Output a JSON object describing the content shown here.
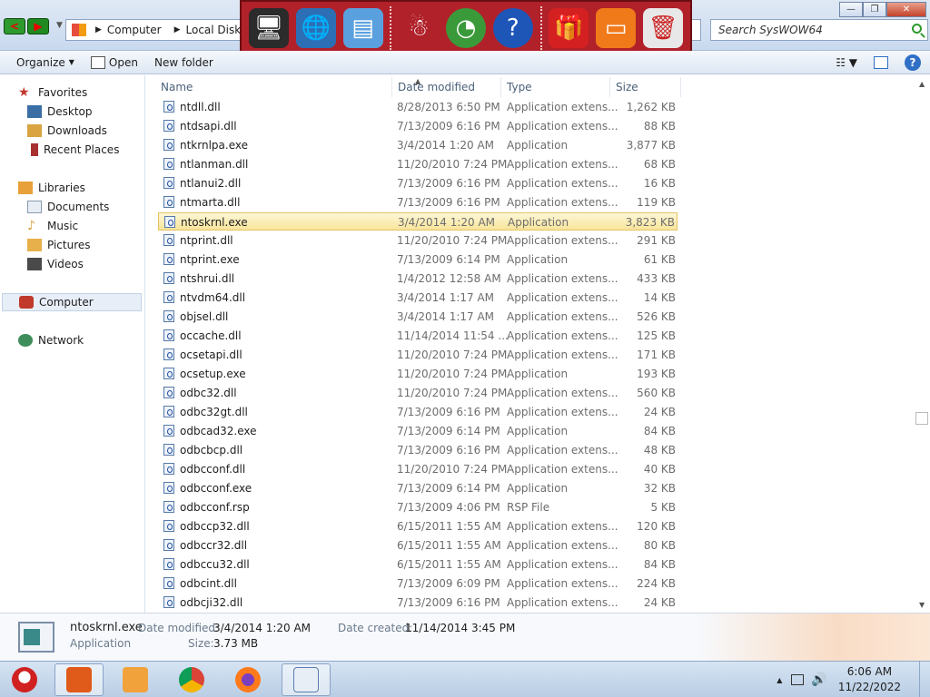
{
  "address": {
    "segments": [
      "Computer",
      "Local Disk (C:)"
    ]
  },
  "search": {
    "placeholder": "Search SysWOW64"
  },
  "window_controls": {
    "minimize": "—",
    "maximize": "❐",
    "close": "✕"
  },
  "nav_buttons": {
    "back": "<",
    "forward": "▶"
  },
  "toolbar": {
    "organize": "Organize",
    "open": "Open",
    "new_folder": "New folder",
    "help": "?"
  },
  "sidebar": {
    "favorites": "Favorites",
    "favorites_items": [
      "Desktop",
      "Downloads",
      "Recent Places"
    ],
    "libraries": "Libraries",
    "libraries_items": [
      "Documents",
      "Music",
      "Pictures",
      "Videos"
    ],
    "computer": "Computer",
    "network": "Network"
  },
  "columns": {
    "name": "Name",
    "date": "Date modified",
    "type": "Type",
    "size": "Size"
  },
  "files": [
    {
      "name": "ntdll.dll",
      "date": "8/28/2013 6:50 PM",
      "type": "Application extens...",
      "size": "1,262 KB"
    },
    {
      "name": "ntdsapi.dll",
      "date": "7/13/2009 6:16 PM",
      "type": "Application extens...",
      "size": "88 KB"
    },
    {
      "name": "ntkrnlpa.exe",
      "date": "3/4/2014 1:20 AM",
      "type": "Application",
      "size": "3,877 KB"
    },
    {
      "name": "ntlanman.dll",
      "date": "11/20/2010 7:24 PM",
      "type": "Application extens...",
      "size": "68 KB"
    },
    {
      "name": "ntlanui2.dll",
      "date": "7/13/2009 6:16 PM",
      "type": "Application extens...",
      "size": "16 KB"
    },
    {
      "name": "ntmarta.dll",
      "date": "7/13/2009 6:16 PM",
      "type": "Application extens...",
      "size": "119 KB"
    },
    {
      "name": "ntoskrnl.exe",
      "date": "3/4/2014 1:20 AM",
      "type": "Application",
      "size": "3,823 KB",
      "selected": true
    },
    {
      "name": "ntprint.dll",
      "date": "11/20/2010 7:24 PM",
      "type": "Application extens...",
      "size": "291 KB"
    },
    {
      "name": "ntprint.exe",
      "date": "7/13/2009 6:14 PM",
      "type": "Application",
      "size": "61 KB"
    },
    {
      "name": "ntshrui.dll",
      "date": "1/4/2012 12:58 AM",
      "type": "Application extens...",
      "size": "433 KB"
    },
    {
      "name": "ntvdm64.dll",
      "date": "3/4/2014 1:17 AM",
      "type": "Application extens...",
      "size": "14 KB"
    },
    {
      "name": "objsel.dll",
      "date": "3/4/2014 1:17 AM",
      "type": "Application extens...",
      "size": "526 KB"
    },
    {
      "name": "occache.dll",
      "date": "11/14/2014 11:54 ...",
      "type": "Application extens...",
      "size": "125 KB"
    },
    {
      "name": "ocsetapi.dll",
      "date": "11/20/2010 7:24 PM",
      "type": "Application extens...",
      "size": "171 KB"
    },
    {
      "name": "ocsetup.exe",
      "date": "11/20/2010 7:24 PM",
      "type": "Application",
      "size": "193 KB"
    },
    {
      "name": "odbc32.dll",
      "date": "11/20/2010 7:24 PM",
      "type": "Application extens...",
      "size": "560 KB"
    },
    {
      "name": "odbc32gt.dll",
      "date": "7/13/2009 6:16 PM",
      "type": "Application extens...",
      "size": "24 KB"
    },
    {
      "name": "odbcad32.exe",
      "date": "7/13/2009 6:14 PM",
      "type": "Application",
      "size": "84 KB"
    },
    {
      "name": "odbcbcp.dll",
      "date": "7/13/2009 6:16 PM",
      "type": "Application extens...",
      "size": "48 KB"
    },
    {
      "name": "odbcconf.dll",
      "date": "11/20/2010 7:24 PM",
      "type": "Application extens...",
      "size": "40 KB"
    },
    {
      "name": "odbcconf.exe",
      "date": "7/13/2009 6:14 PM",
      "type": "Application",
      "size": "32 KB"
    },
    {
      "name": "odbcconf.rsp",
      "date": "7/13/2009 4:06 PM",
      "type": "RSP File",
      "size": "5 KB"
    },
    {
      "name": "odbccp32.dll",
      "date": "6/15/2011 1:55 AM",
      "type": "Application extens...",
      "size": "120 KB"
    },
    {
      "name": "odbccr32.dll",
      "date": "6/15/2011 1:55 AM",
      "type": "Application extens...",
      "size": "80 KB"
    },
    {
      "name": "odbccu32.dll",
      "date": "6/15/2011 1:55 AM",
      "type": "Application extens...",
      "size": "84 KB"
    },
    {
      "name": "odbcint.dll",
      "date": "7/13/2009 6:09 PM",
      "type": "Application extens...",
      "size": "224 KB"
    },
    {
      "name": "odbcji32.dll",
      "date": "7/13/2009 6:16 PM",
      "type": "Application extens...",
      "size": "24 KB"
    }
  ],
  "details": {
    "filename": "ntoskrnl.exe",
    "type": "Application",
    "date_modified_label": "Date modified:",
    "date_modified": "3/4/2014 1:20 AM",
    "size_label": "Size:",
    "size": "3.73 MB",
    "date_created_label": "Date created:",
    "date_created": "11/14/2014 3:45 PM"
  },
  "taskbar": {
    "apps": [
      "start-santa-icon",
      "file-manager-icon",
      "media-player-icon",
      "chrome-icon",
      "firefox-icon",
      "checklist-app-icon"
    ],
    "clock_time": "6:06 AM",
    "clock_date": "11/22/2022"
  },
  "dock": {
    "icons": [
      "computer-icon",
      "globe-icon",
      "control-panel-icon",
      "snowman-icon",
      "shield-icon",
      "help-icon",
      "gift-icon",
      "folder-icon",
      "recycle-bin-icon"
    ]
  },
  "colors": {
    "dock_bg": "#b1212a",
    "selection_bg": "#f8e59a",
    "link_blue": "#1f4fa0"
  }
}
